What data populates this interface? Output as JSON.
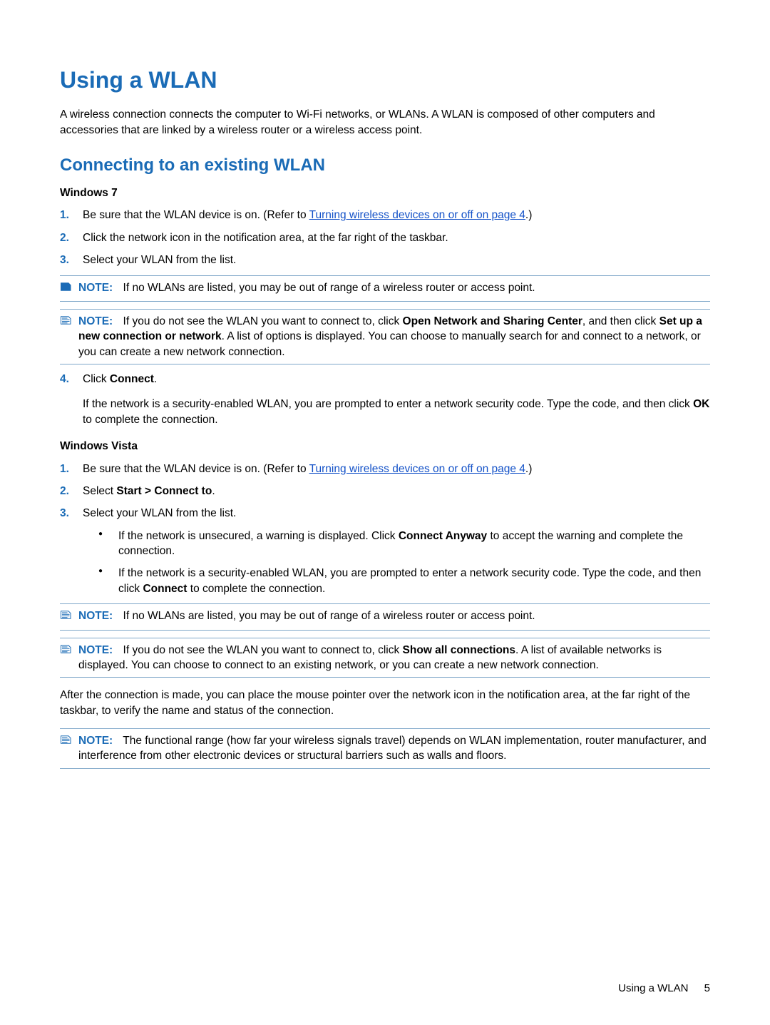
{
  "heading": "Using a WLAN",
  "intro": "A wireless connection connects the computer to Wi-Fi networks, or WLANs. A WLAN is composed of other computers and accessories that are linked by a wireless router or a wireless access point.",
  "section2": "Connecting to an existing WLAN",
  "win7": {
    "title": "Windows 7",
    "step1_a": "Be sure that the WLAN device is on. (Refer to ",
    "step1_link": "Turning wireless devices on or off on page 4",
    "step1_b": ".)",
    "step2": "Click the network icon in the notification area, at the far right of the taskbar.",
    "step3": "Select your WLAN from the list.",
    "note1": "If no WLANs are listed, you may be out of range of a wireless router or access point.",
    "note2_a": "If you do not see the WLAN you want to connect to, click ",
    "note2_b1": "Open Network and Sharing Center",
    "note2_c": ", and then click ",
    "note2_b2": "Set up a new connection or network",
    "note2_d": ". A list of options is displayed. You can choose to manually search for and connect to a network, or you can create a new network connection.",
    "step4_a": "Click ",
    "step4_b": "Connect",
    "step4_c": ".",
    "step4_p2_a": "If the network is a security-enabled WLAN, you are prompted to enter a network security code. Type the code, and then click ",
    "step4_p2_b": "OK",
    "step4_p2_c": " to complete the connection."
  },
  "vista": {
    "title": "Windows Vista",
    "step1_a": "Be sure that the WLAN device is on. (Refer to ",
    "step1_link": "Turning wireless devices on or off on page 4",
    "step1_b": ".)",
    "step2_a": "Select ",
    "step2_b": "Start > Connect to",
    "step2_c": ".",
    "step3": "Select your WLAN from the list.",
    "bullet1_a": "If the network is unsecured, a warning is displayed. Click ",
    "bullet1_b": "Connect Anyway",
    "bullet1_c": " to accept the warning and complete the connection.",
    "bullet2_a": "If the network is a security-enabled WLAN, you are prompted to enter a network security code. Type the code, and then click ",
    "bullet2_b": "Connect",
    "bullet2_c": " to complete the connection.",
    "note1": "If no WLANs are listed, you may be out of range of a wireless router or access point.",
    "note2_a": "If you do not see the WLAN you want to connect to, click ",
    "note2_b": "Show all connections",
    "note2_c": ". A list of available networks is displayed. You can choose to connect to an existing network, or you can create a new network connection."
  },
  "after": "After the connection is made, you can place the mouse pointer over the network icon in the notification area, at the far right of the taskbar, to verify the name and status of the connection.",
  "final_note": "The functional range (how far your wireless signals travel) depends on WLAN implementation, router manufacturer, and interference from other electronic devices or structural barriers such as walls and floors.",
  "note_label": "NOTE:",
  "nums": {
    "n1": "1.",
    "n2": "2.",
    "n3": "3.",
    "n4": "4."
  },
  "footer": {
    "text": "Using a WLAN",
    "page": "5"
  }
}
